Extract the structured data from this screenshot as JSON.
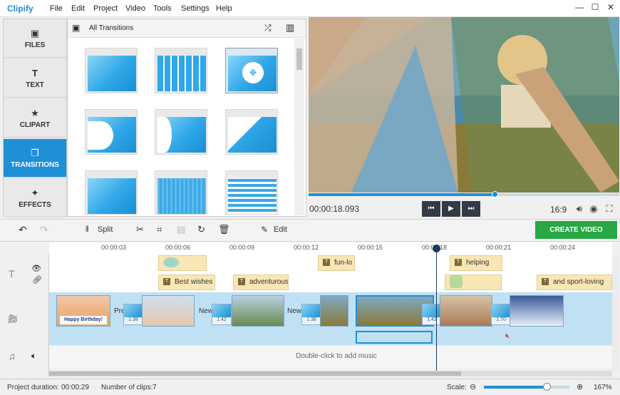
{
  "app": {
    "name": "Clipify"
  },
  "menu": [
    "File",
    "Edit",
    "Project",
    "Video",
    "Tools",
    "Settings",
    "Help"
  ],
  "window_controls": [
    "minimize",
    "maximize",
    "close"
  ],
  "sidebar": {
    "tabs": [
      {
        "label": "FILES",
        "icon": "image-icon",
        "glyph": "▣"
      },
      {
        "label": "TEXT",
        "icon": "text-icon",
        "glyph": "T"
      },
      {
        "label": "CLIPART",
        "icon": "star-icon",
        "glyph": "★"
      },
      {
        "label": "TRANSITIONS",
        "icon": "transitions-icon",
        "glyph": "❐",
        "active": true
      },
      {
        "label": "EFFECTS",
        "icon": "magic-wand-icon",
        "glyph": "✦"
      }
    ]
  },
  "transitions_panel": {
    "title": "All Transitions",
    "thumbnails_count": 9,
    "selected_index": 2
  },
  "preview": {
    "timecode": "00:00:18.093",
    "aspect_ratio": "16:9",
    "progress": 0.6,
    "controls": [
      "previous",
      "play",
      "next"
    ]
  },
  "toolbar": {
    "split_label": "Split",
    "edit_label": "Edit",
    "create_video_label": "CREATE VIDEO"
  },
  "timeline": {
    "ruler_ticks": [
      "00:00:03",
      "00:00:06",
      "00:00:09",
      "00:00:12",
      "00:00:15",
      "00:00:18",
      "00:00:21",
      "00:00:24"
    ],
    "captions": [
      "Best wishes",
      "adventurous",
      "fun-lo",
      "helping",
      "and sport-loving"
    ],
    "clip_labels": [
      "Pre",
      "New",
      "New"
    ],
    "transition_durations": [
      "1.38",
      "1.42",
      "1.38",
      "1.42",
      "1.70"
    ],
    "birthday_text": "Happy Birthday!",
    "music_hint": "Double-click to add music"
  },
  "status": {
    "project_duration_label": "Project duration:",
    "project_duration": "00:00:29",
    "clip_count_label": "Number of clips:",
    "clip_count": "7",
    "scale_label": "Scale:",
    "scale_value": "167%",
    "scale_level": 0.73
  },
  "colors": {
    "accent": "#1f8fd8",
    "create": "#28a745",
    "caption": "#f8e6b4"
  }
}
